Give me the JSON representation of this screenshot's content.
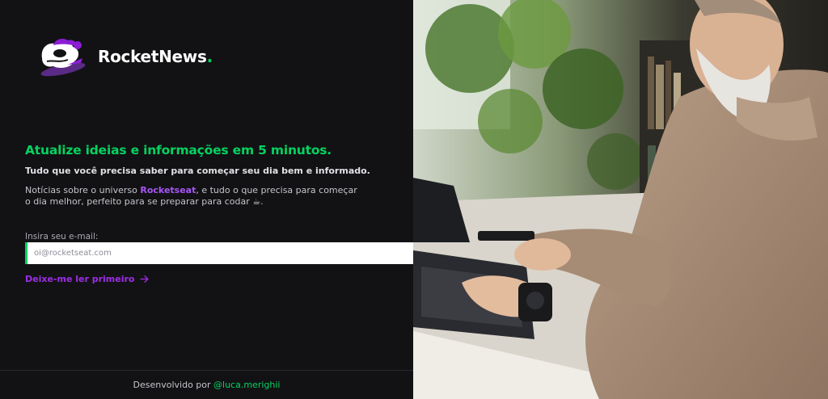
{
  "brand": {
    "name": "RocketNews",
    "dot": "."
  },
  "hero": {
    "headline": "Atualize ideias e informações em 5 minutos.",
    "subheadline": "Tudo que você precisa saber para começar seu dia bem e informado.",
    "desc_before": "Notícias sobre o universo ",
    "desc_accent": "Rocketseat",
    "desc_after": ", e tudo o que precisa para começar o dia melhor, perfeito para se preparar para codar ☕."
  },
  "form": {
    "label": "Insira seu e-mail:",
    "placeholder": "oi@rocketseat.com",
    "send_icon": "send-icon"
  },
  "cta": {
    "label": "Deixe-me ler primeiro",
    "icon": "arrow-right-icon"
  },
  "footer": {
    "prefix": "Desenvolvido por ",
    "handle": "@luca.merighii"
  },
  "colors": {
    "background": "#121214",
    "accent_green": "#04d361",
    "accent_purple": "#8b1dd6"
  }
}
